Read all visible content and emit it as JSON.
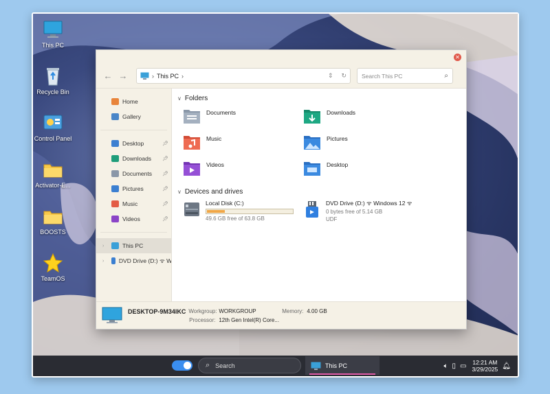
{
  "desktop": {
    "icons": [
      {
        "label": "This PC",
        "icon": "monitor-icon"
      },
      {
        "label": "Recycle Bin",
        "icon": "recycle-bin-icon"
      },
      {
        "label": "Control Panel",
        "icon": "control-panel-icon"
      },
      {
        "label": "Activator-E...",
        "icon": "folder-icon"
      },
      {
        "label": "BOOSTS",
        "icon": "folder-icon"
      },
      {
        "label": "TeamOS",
        "icon": "star-icon"
      }
    ]
  },
  "explorer": {
    "address": {
      "path": "This PC"
    },
    "search_placeholder": "Search This PC",
    "sidebar": {
      "top": [
        {
          "label": "Home",
          "icon": "home-icon",
          "color": "#e8843a"
        },
        {
          "label": "Gallery",
          "icon": "gallery-icon",
          "color": "#4a86c8"
        }
      ],
      "pinned": [
        {
          "label": "Desktop",
          "icon": "desktop-folder-icon",
          "color": "#3b7fd1"
        },
        {
          "label": "Downloads",
          "icon": "downloads-folder-icon",
          "color": "#1e9d7a"
        },
        {
          "label": "Documents",
          "icon": "documents-folder-icon",
          "color": "#8a97a8"
        },
        {
          "label": "Pictures",
          "icon": "pictures-folder-icon",
          "color": "#3b7fd1"
        },
        {
          "label": "Music",
          "icon": "music-folder-icon",
          "color": "#e35c45"
        },
        {
          "label": "Videos",
          "icon": "videos-folder-icon",
          "color": "#8b44c7"
        }
      ],
      "tree": [
        {
          "label": "This PC",
          "icon": "monitor-icon",
          "color": "#3aa0d8"
        },
        {
          "label": "DVD Drive (D:) ᯤ W",
          "icon": "dvd-drive-icon",
          "color": "#3b7fd1"
        }
      ]
    },
    "folders_heading": "Folders",
    "folders": [
      {
        "name": "Documents",
        "icon": "documents-folder-icon",
        "color": "#8a97a8"
      },
      {
        "name": "Downloads",
        "icon": "downloads-folder-icon",
        "color": "#1e9d7a"
      },
      {
        "name": "Music",
        "icon": "music-folder-icon",
        "color": "#e35c45"
      },
      {
        "name": "Pictures",
        "icon": "pictures-folder-icon",
        "color": "#3b7fd1"
      },
      {
        "name": "Videos",
        "icon": "videos-folder-icon",
        "color": "#8b44c7"
      },
      {
        "name": "Desktop",
        "icon": "desktop-folder-icon",
        "color": "#3b7fd1"
      }
    ],
    "drives_heading": "Devices and drives",
    "drives": [
      {
        "name": "Local Disk (C:)",
        "free": "49.6 GB free of 63.8 GB",
        "used_fraction": 0.22,
        "icon": "hard-disk-icon"
      },
      {
        "name": "DVD Drive (D:) ᯤ Windows 12 ᯤ",
        "free": "0 bytes free of 5.14 GB",
        "fs": "UDF",
        "icon": "dvd-drive-icon"
      }
    ],
    "details": {
      "pc_name": "DESKTOP-9M34IKC",
      "workgroup_label": "Workgroup:",
      "workgroup": "WORKGROUP",
      "memory_label": "Memory:",
      "memory": "4.00 GB",
      "processor_label": "Processor:",
      "processor": "12th Gen Intel(R) Core..."
    }
  },
  "taskbar": {
    "search_label": "Search",
    "app_label": "This PC",
    "time": "12:21 AM",
    "date": "3/29/2025"
  }
}
